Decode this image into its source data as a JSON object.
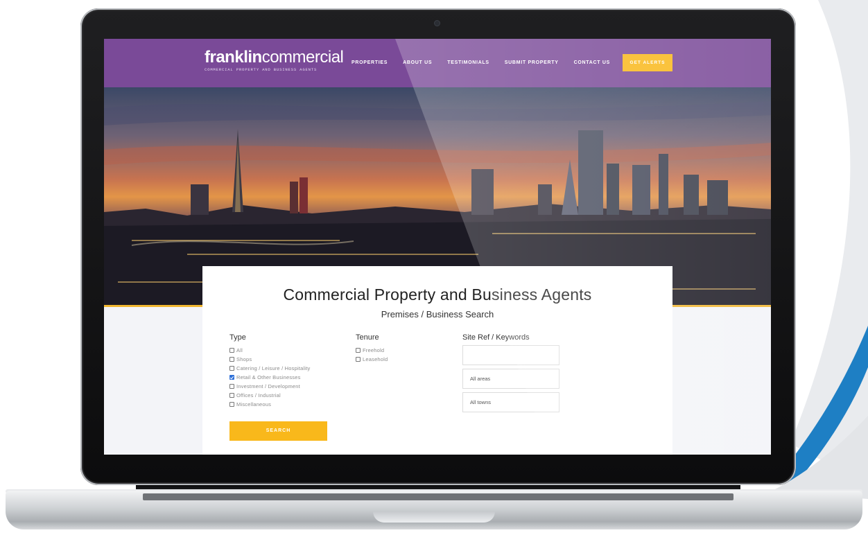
{
  "site": {
    "logo_bold": "franklin",
    "logo_light": "commercial",
    "logo_tagline": "COMMERCIAL PROPERTY AND BUSINESS AGENTS"
  },
  "nav": {
    "items": [
      {
        "label": "PROPERTIES"
      },
      {
        "label": "ABOUT US"
      },
      {
        "label": "TESTIMONIALS"
      },
      {
        "label": "SUBMIT PROPERTY"
      },
      {
        "label": "CONTACT US"
      }
    ],
    "cta_label": "GET ALERTS"
  },
  "search": {
    "title": "Commercial Property and Business Agents",
    "subtitle": "Premises / Business Search",
    "type_label": "Type",
    "type_options": [
      {
        "label": "All",
        "checked": false
      },
      {
        "label": "Shops",
        "checked": false
      },
      {
        "label": "Catering / Leisure / Hospitality",
        "checked": false
      },
      {
        "label": "Retail & Other Businesses",
        "checked": true
      },
      {
        "label": "Investment / Development",
        "checked": false
      },
      {
        "label": "Offices / Industrial",
        "checked": false
      },
      {
        "label": "Miscellaneous",
        "checked": false
      }
    ],
    "tenure_label": "Tenure",
    "tenure_options": [
      {
        "label": "Freehold",
        "checked": false
      },
      {
        "label": "Leasehold",
        "checked": false
      }
    ],
    "keywords_label": "Site Ref / Keywords",
    "keywords_value": "",
    "area_value": "All areas",
    "town_value": "All towns",
    "search_button": "SEARCH"
  },
  "colors": {
    "nav_purple": "#7a4a98",
    "accent_yellow": "#f9b81b",
    "checkbox_blue": "#2d6fd8",
    "swoosh_blue": "#1e7fc4"
  }
}
